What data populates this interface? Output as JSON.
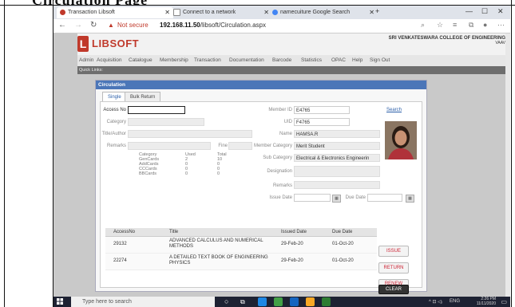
{
  "document": {
    "heading": "Circulation Page"
  },
  "browser": {
    "tabs": [
      {
        "label": "Transaction Libsoft",
        "active": true
      },
      {
        "label": "Connect to a network",
        "active": false
      },
      {
        "label": "namecuiture  Google Search",
        "active": false
      }
    ],
    "new_tab": "+",
    "address": {
      "warning_icon": "warning-icon",
      "not_secure": "Not secure",
      "host": "192.168.11.50",
      "path": "/libsoft/Circulation.aspx"
    }
  },
  "app": {
    "logo_letter": "L",
    "logo_text": "LIBSOFT",
    "college_name": "SRI VENKATESWARA COLLEGE OF ENGINEERING",
    "college_sub": "VAAV",
    "menu": [
      "Admin",
      "Acquisition",
      "Catalogue",
      "Membership",
      "Transaction",
      "Documentation",
      "Barcode",
      "Statistics",
      "OPAC",
      "Help",
      "Sign Out"
    ],
    "quick_links": "Quick Links:"
  },
  "circulation": {
    "title": "Circulation",
    "tabs": [
      "Single",
      "Bulk Return"
    ],
    "left_fields": {
      "access_no": {
        "label": "Access No",
        "value": ""
      },
      "category": {
        "label": "Category",
        "value": ""
      },
      "title_author": {
        "label": "Title/Author",
        "value": ""
      },
      "remarks": {
        "label": "Remarks",
        "value": ""
      },
      "fine": {
        "label": "Fine",
        "value": ""
      }
    },
    "card_stats": {
      "headers": [
        "Category",
        "Used",
        "Total"
      ],
      "rows": [
        [
          "GenCards",
          "2",
          "10"
        ],
        [
          "AddCards",
          "0",
          "0"
        ],
        [
          "CCCards",
          "0",
          "0"
        ],
        [
          "BBCards",
          "0",
          "0"
        ]
      ]
    },
    "member": {
      "member_id": {
        "label": "Member ID",
        "value": "E4765"
      },
      "uid": {
        "label": "UID",
        "value": "F4765"
      },
      "name": {
        "label": "Name",
        "value": "HAMSA.R"
      },
      "member_category": {
        "label": "Member Category",
        "value": "Merit Student"
      },
      "sub_category": {
        "label": "Sub Category",
        "value": "Electrical & Electronics Engineerin"
      },
      "designation": {
        "label": "Designation",
        "value": ""
      },
      "remarks": {
        "label": "Remarks",
        "value": ""
      },
      "issue_date": {
        "label": "Issue Date",
        "value": ""
      },
      "due_date": {
        "label": "Due Date",
        "value": ""
      },
      "search_link": "Search"
    },
    "table": {
      "headers": [
        "AccessNo",
        "Title",
        "Issued Date",
        "Due Date"
      ],
      "rows": [
        [
          "29132",
          "ADVANCED CALCULUS AND NUMERICAL METHODS",
          "29-Feb-20",
          "01-Oct-20"
        ],
        [
          "22274",
          "A DETAILED TEXT BOOK OF ENGINEERING PHYSICS",
          "29-Feb-20",
          "01-Oct-20"
        ]
      ]
    },
    "buttons": [
      "ISSUE",
      "RETURN",
      "RENEW",
      "CLEAR"
    ]
  },
  "taskbar": {
    "search_placeholder": "Type here to search",
    "lang": "ENG",
    "time": "2:26 PM",
    "date": "11/11/2020"
  }
}
